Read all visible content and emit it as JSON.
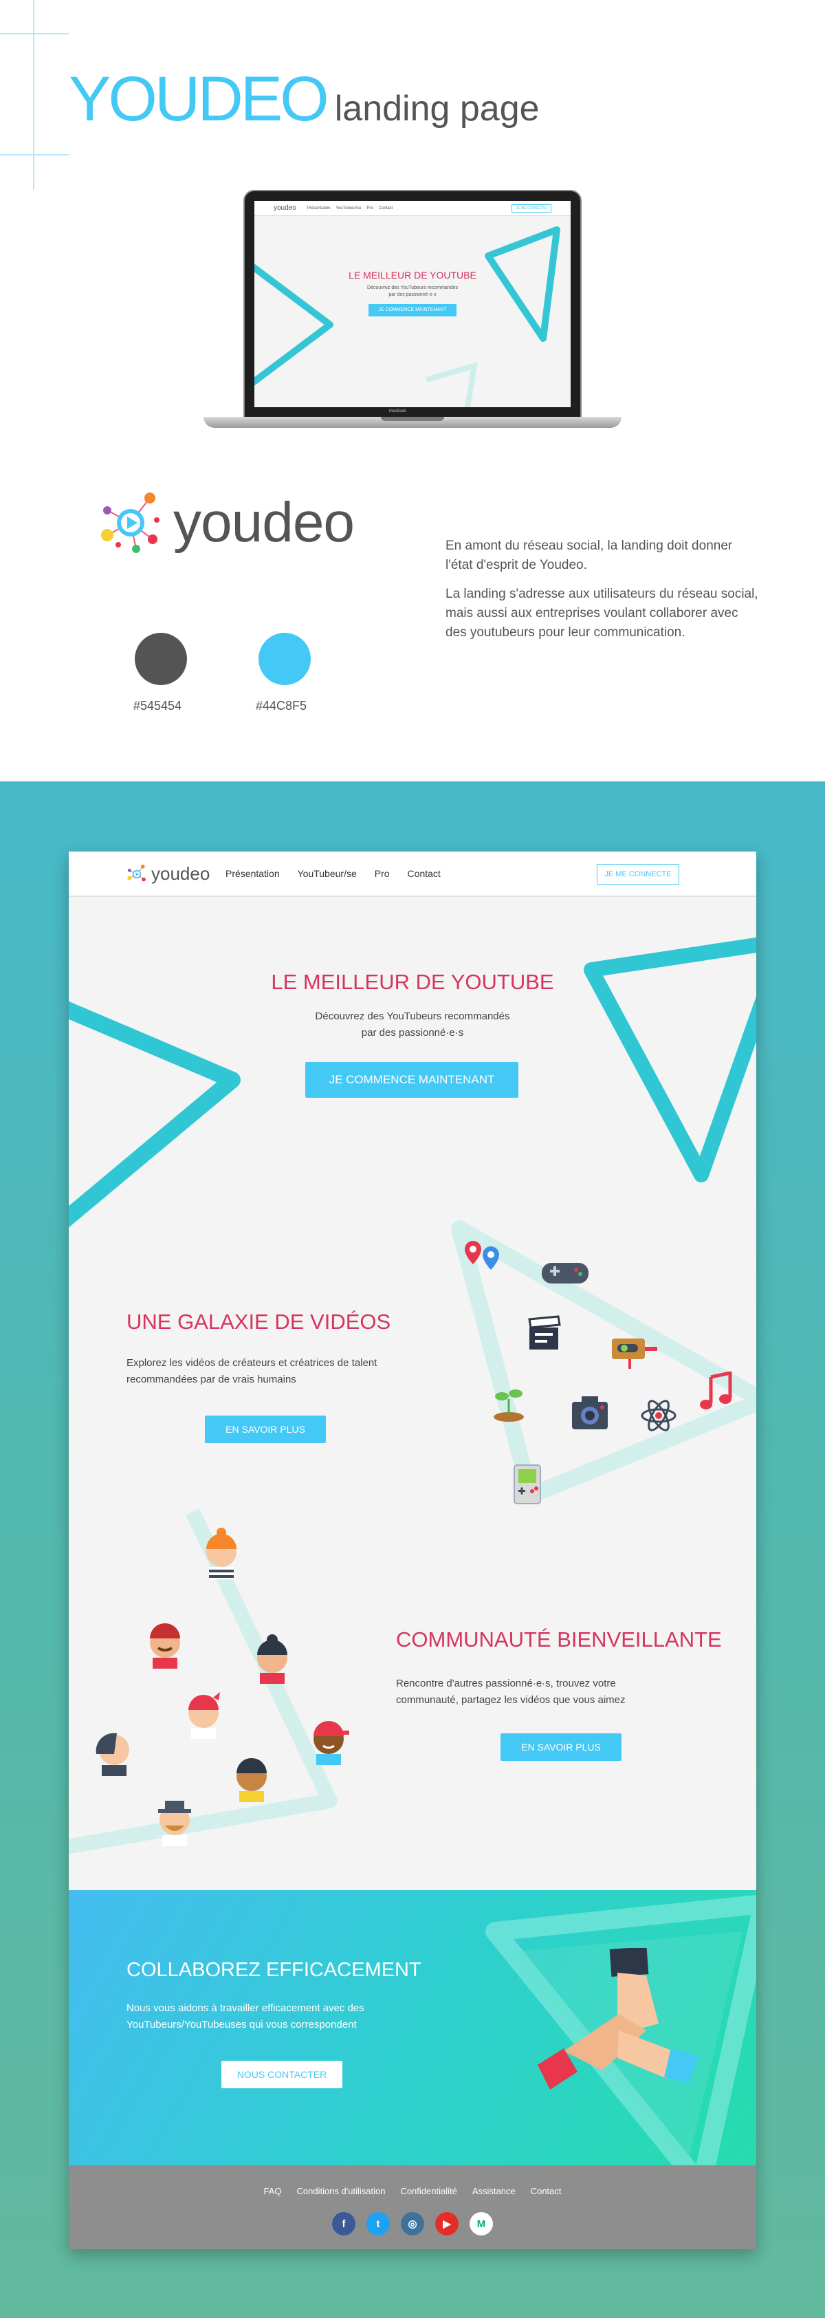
{
  "presentation": {
    "brand": "YOUDEO",
    "subtitle": "landing page",
    "logo_wordmark": "youdeo",
    "colors": [
      {
        "hex": "#545454",
        "label": "#545454"
      },
      {
        "hex": "#44C8F5",
        "label": "#44C8F5"
      }
    ],
    "description": [
      "En amont du réseau social, la landing doit donner l'état d'esprit de Youdeo.",
      "La landing s'adresse aux utilisateurs du réseau social, mais aussi aux entreprises voulant collaborer avec des youtubeurs pour leur communication."
    ],
    "laptop_label": "MacBook"
  },
  "site": {
    "logo_wordmark": "youdeo",
    "nav": [
      "Présentation",
      "YouTubeur/se",
      "Pro",
      "Contact"
    ],
    "nav_button": "JE ME CONNECTE",
    "hero": {
      "title": "LE MEILLEUR DE YOUTUBE",
      "subtitle_line1": "Découvrez des YouTubeurs recommandés",
      "subtitle_line2": "par des passionné·e·s",
      "cta": "JE COMMENCE MAINTENANT"
    },
    "galaxy": {
      "title": "UNE GALAXIE DE VIDÉOS",
      "subtitle_line1": "Explorez les vidéos de créateurs et créatrices de talent",
      "subtitle_line2": "recommandées par de vrais humains",
      "cta": "EN SAVOIR PLUS",
      "icons": [
        "map-pins-icon",
        "gamepad-icon",
        "clapperboard-icon",
        "toggle-switch-icon",
        "sprout-icon",
        "camera-icon",
        "atom-icon",
        "music-note-icon",
        "gameboy-icon"
      ]
    },
    "community": {
      "title": "COMMUNAUTÉ BIENVEILLANTE",
      "subtitle_line1": "Rencontre d'autres passionné·e·s, trouvez votre",
      "subtitle_line2": "communauté, partagez les vidéos que vous aimez",
      "cta": "EN SAVOIR PLUS"
    },
    "collab": {
      "title": "COLLABOREZ EFFICACEMENT",
      "subtitle_line1": "Nous vous aidons à travailler efficacement avec des",
      "subtitle_line2": "YouTubeurs/YouTubeuses qui vous correspondent",
      "cta": "NOUS CONTACTER"
    },
    "footer_links": [
      "FAQ",
      "Conditions d'utilisation",
      "Confidentialité",
      "Assistance",
      "Contact"
    ],
    "socials": [
      {
        "name": "facebook-icon",
        "glyph": "f",
        "color": "#3b5998"
      },
      {
        "name": "twitter-icon",
        "glyph": "t",
        "color": "#1da1f2"
      },
      {
        "name": "instagram-icon",
        "glyph": "◎",
        "color": "#3f729b"
      },
      {
        "name": "youtube-icon",
        "glyph": "▶",
        "color": "#e52d27"
      },
      {
        "name": "medium-icon",
        "glyph": "M",
        "color": "#ffffff"
      }
    ]
  }
}
